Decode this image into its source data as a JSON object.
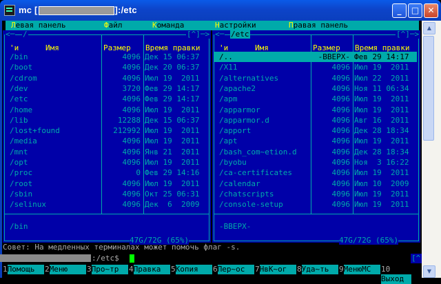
{
  "window": {
    "title_prefix": "mc [",
    "title_suffix": "]:/etc",
    "minimize_glyph": "_",
    "maximize_glyph": "□",
    "close_glyph": "✕",
    "icon": "terminal-icon"
  },
  "menu": [
    {
      "hotkey": "Л",
      "rest": "евая панель"
    },
    {
      "hotkey": "Ф",
      "rest": "айл"
    },
    {
      "hotkey": "К",
      "rest": "оманда"
    },
    {
      "hotkey": "Н",
      "rest": "астройки"
    },
    {
      "hotkey": "П",
      "rest": "равая панель"
    }
  ],
  "left_panel": {
    "path": "/",
    "corner": "[^]",
    "arrows_left": "<─",
    "arrows_right": "─>",
    "header": {
      "sort": "'и",
      "name": "Имя",
      "size": "Размер",
      "time": "Время правки"
    },
    "rows": [
      {
        "name": "/bin",
        "size": "4096",
        "time": "Дек 15 06:37"
      },
      {
        "name": "/boot",
        "size": "4096",
        "time": "Дек 20 06:37"
      },
      {
        "name": "/cdrom",
        "size": "4096",
        "time": "Июл 19  2011"
      },
      {
        "name": "/dev",
        "size": "3720",
        "time": "Фев 29 14:17"
      },
      {
        "name": "/etc",
        "size": "4096",
        "time": "Фев 29 14:17"
      },
      {
        "name": "/home",
        "size": "4096",
        "time": "Июл 19  2011"
      },
      {
        "name": "/lib",
        "size": "12288",
        "time": "Дек 15 06:37"
      },
      {
        "name": "/lost+found",
        "size": "212992",
        "time": "Июл 19  2011"
      },
      {
        "name": "/media",
        "size": "4096",
        "time": "Июл 19  2011"
      },
      {
        "name": "/mnt",
        "size": "4096",
        "time": "Янв 21  2011"
      },
      {
        "name": "/opt",
        "size": "4096",
        "time": "Июл 19  2011"
      },
      {
        "name": "/proc",
        "size": "0",
        "time": "Фев 29 14:16"
      },
      {
        "name": "/root",
        "size": "4096",
        "time": "Июл 19  2011"
      },
      {
        "name": "/sbin",
        "size": "4096",
        "time": "Окт 25 06:31"
      },
      {
        "name": "/selinux",
        "size": "4096",
        "time": "Дек  6  2009"
      }
    ],
    "mini_status": "/bin",
    "disk": "47G/72G (65%)"
  },
  "right_panel": {
    "path": "/etc",
    "corner": "[^]",
    "arrows_left": "<─",
    "arrows_right": "─>",
    "header": {
      "sort": "'и",
      "name": "Имя",
      "size": "Размер",
      "time": "Время правки"
    },
    "rows": [
      {
        "name": "/..",
        "size": "-ВВЕРХ-",
        "time": "Фев 29 14:17",
        "selected": true
      },
      {
        "name": "/X11",
        "size": "4096",
        "time": "Июл 19  2011"
      },
      {
        "name": "/alternatives",
        "size": "4096",
        "time": "Июл 22  2011"
      },
      {
        "name": "/apache2",
        "size": "4096",
        "time": "Ноя 11 06:34"
      },
      {
        "name": "/apm",
        "size": "4096",
        "time": "Июл 19  2011"
      },
      {
        "name": "/apparmor",
        "size": "4096",
        "time": "Июл 19  2011"
      },
      {
        "name": "/apparmor.d",
        "size": "4096",
        "time": "Авг 16  2011"
      },
      {
        "name": "/apport",
        "size": "4096",
        "time": "Дек 28 18:34"
      },
      {
        "name": "/apt",
        "size": "4096",
        "time": "Июл 19  2011"
      },
      {
        "name": "/bash_com~etion.d",
        "size": "4096",
        "time": "Дек 28 18:34"
      },
      {
        "name": "/byobu",
        "size": "4096",
        "time": "Ноя  3 16:22"
      },
      {
        "name": "/ca-certificates",
        "size": "4096",
        "time": "Июл 19  2011"
      },
      {
        "name": "/calendar",
        "size": "4096",
        "time": "Июл 10  2009"
      },
      {
        "name": "/chatscripts",
        "size": "4096",
        "time": "Июл 19  2011"
      },
      {
        "name": "/console-setup",
        "size": "4096",
        "time": "Июл 19  2011"
      }
    ],
    "mini_status": "-ВВЕРХ-",
    "disk": "47G/72G (65%)"
  },
  "hint": "Совет: На медленных терминалах может помочь флаг -s.",
  "command_line": {
    "prompt": ":/etc$",
    "corner": "[^]"
  },
  "fkeys": [
    {
      "num": "1",
      "label": "Помощь"
    },
    {
      "num": "2",
      "label": "Меню"
    },
    {
      "num": "3",
      "label": "Про~тр"
    },
    {
      "num": "4",
      "label": "Правка"
    },
    {
      "num": "5",
      "label": "Копия"
    },
    {
      "num": "6",
      "label": "Пер~ос"
    },
    {
      "num": "7",
      "label": "НвК~ог"
    },
    {
      "num": "8",
      "label": "Уда~ть"
    },
    {
      "num": "9",
      "label": "МенюМС"
    },
    {
      "num": "10",
      "label": "Выход"
    }
  ]
}
